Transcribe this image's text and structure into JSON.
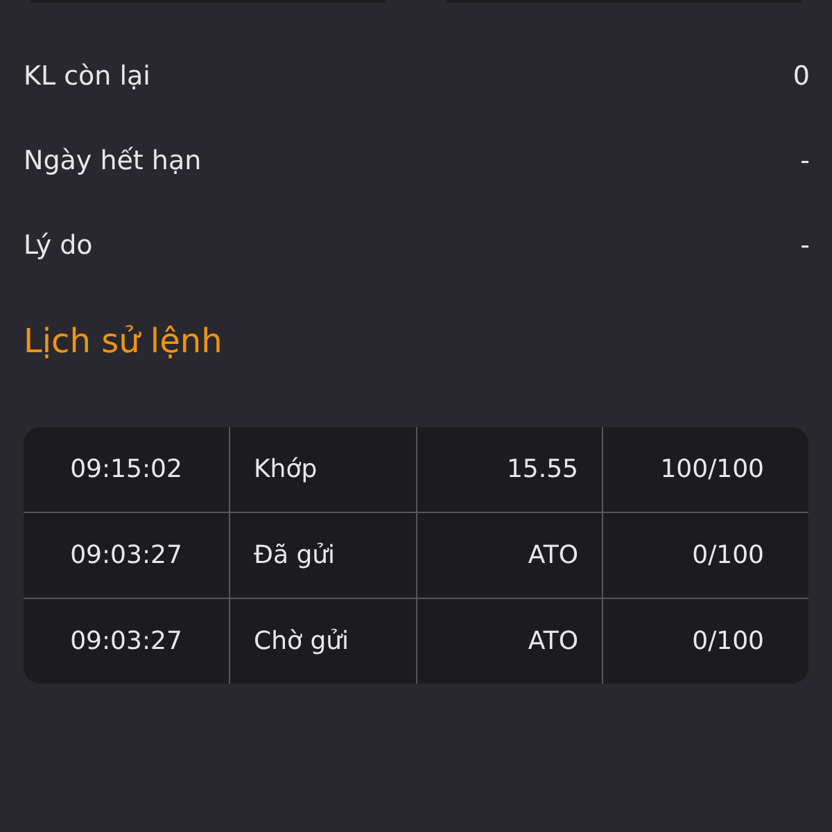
{
  "details": [
    {
      "label": "KL còn lại",
      "value": "0"
    },
    {
      "label": "Ngày hết hạn",
      "value": "-"
    },
    {
      "label": "Lý do",
      "value": "-"
    }
  ],
  "history": {
    "title": "Lịch sử lệnh",
    "rows": [
      [
        "09:15:02",
        "Khớp",
        "15.55",
        "100/100"
      ],
      [
        "09:03:27",
        "Đã gửi",
        "ATO",
        "0/100"
      ],
      [
        "09:03:27",
        "Chờ gửi",
        "ATO",
        "0/100"
      ]
    ]
  }
}
